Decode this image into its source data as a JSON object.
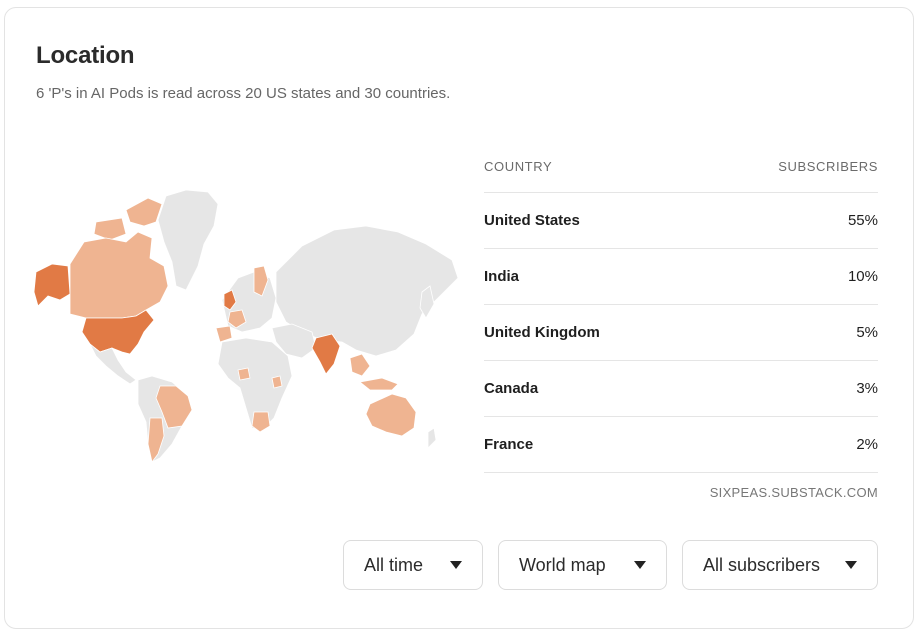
{
  "header": {
    "title": "Location",
    "subtitle": "6 'P's in AI Pods is read across 20 US states and 30 countries."
  },
  "table": {
    "col_country": "COUNTRY",
    "col_subscribers": "SUBSCRIBERS",
    "rows": [
      {
        "country": "United States",
        "value": "55%"
      },
      {
        "country": "India",
        "value": "10%"
      },
      {
        "country": "United Kingdom",
        "value": "5%"
      },
      {
        "country": "Canada",
        "value": "3%"
      },
      {
        "country": "France",
        "value": "2%"
      }
    ],
    "source": "SIXPEAS.SUBSTACK.COM"
  },
  "filters": {
    "time": "All time",
    "view": "World map",
    "audience": "All subscribers"
  },
  "map_colors": {
    "empty": "#e6e6e6",
    "low": "#efb491",
    "high": "#e17a45",
    "border": "#ffffff"
  }
}
